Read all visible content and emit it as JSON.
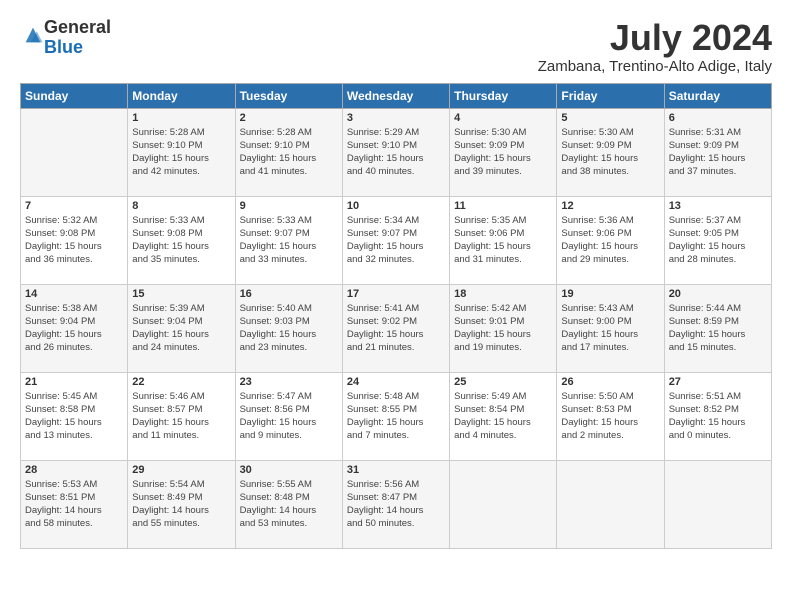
{
  "logo": {
    "general": "General",
    "blue": "Blue"
  },
  "title": "July 2024",
  "location": "Zambana, Trentino-Alto Adige, Italy",
  "days_of_week": [
    "Sunday",
    "Monday",
    "Tuesday",
    "Wednesday",
    "Thursday",
    "Friday",
    "Saturday"
  ],
  "weeks": [
    [
      {
        "day": "",
        "info": ""
      },
      {
        "day": "1",
        "info": "Sunrise: 5:28 AM\nSunset: 9:10 PM\nDaylight: 15 hours\nand 42 minutes."
      },
      {
        "day": "2",
        "info": "Sunrise: 5:28 AM\nSunset: 9:10 PM\nDaylight: 15 hours\nand 41 minutes."
      },
      {
        "day": "3",
        "info": "Sunrise: 5:29 AM\nSunset: 9:10 PM\nDaylight: 15 hours\nand 40 minutes."
      },
      {
        "day": "4",
        "info": "Sunrise: 5:30 AM\nSunset: 9:09 PM\nDaylight: 15 hours\nand 39 minutes."
      },
      {
        "day": "5",
        "info": "Sunrise: 5:30 AM\nSunset: 9:09 PM\nDaylight: 15 hours\nand 38 minutes."
      },
      {
        "day": "6",
        "info": "Sunrise: 5:31 AM\nSunset: 9:09 PM\nDaylight: 15 hours\nand 37 minutes."
      }
    ],
    [
      {
        "day": "7",
        "info": "Sunrise: 5:32 AM\nSunset: 9:08 PM\nDaylight: 15 hours\nand 36 minutes."
      },
      {
        "day": "8",
        "info": "Sunrise: 5:33 AM\nSunset: 9:08 PM\nDaylight: 15 hours\nand 35 minutes."
      },
      {
        "day": "9",
        "info": "Sunrise: 5:33 AM\nSunset: 9:07 PM\nDaylight: 15 hours\nand 33 minutes."
      },
      {
        "day": "10",
        "info": "Sunrise: 5:34 AM\nSunset: 9:07 PM\nDaylight: 15 hours\nand 32 minutes."
      },
      {
        "day": "11",
        "info": "Sunrise: 5:35 AM\nSunset: 9:06 PM\nDaylight: 15 hours\nand 31 minutes."
      },
      {
        "day": "12",
        "info": "Sunrise: 5:36 AM\nSunset: 9:06 PM\nDaylight: 15 hours\nand 29 minutes."
      },
      {
        "day": "13",
        "info": "Sunrise: 5:37 AM\nSunset: 9:05 PM\nDaylight: 15 hours\nand 28 minutes."
      }
    ],
    [
      {
        "day": "14",
        "info": "Sunrise: 5:38 AM\nSunset: 9:04 PM\nDaylight: 15 hours\nand 26 minutes."
      },
      {
        "day": "15",
        "info": "Sunrise: 5:39 AM\nSunset: 9:04 PM\nDaylight: 15 hours\nand 24 minutes."
      },
      {
        "day": "16",
        "info": "Sunrise: 5:40 AM\nSunset: 9:03 PM\nDaylight: 15 hours\nand 23 minutes."
      },
      {
        "day": "17",
        "info": "Sunrise: 5:41 AM\nSunset: 9:02 PM\nDaylight: 15 hours\nand 21 minutes."
      },
      {
        "day": "18",
        "info": "Sunrise: 5:42 AM\nSunset: 9:01 PM\nDaylight: 15 hours\nand 19 minutes."
      },
      {
        "day": "19",
        "info": "Sunrise: 5:43 AM\nSunset: 9:00 PM\nDaylight: 15 hours\nand 17 minutes."
      },
      {
        "day": "20",
        "info": "Sunrise: 5:44 AM\nSunset: 8:59 PM\nDaylight: 15 hours\nand 15 minutes."
      }
    ],
    [
      {
        "day": "21",
        "info": "Sunrise: 5:45 AM\nSunset: 8:58 PM\nDaylight: 15 hours\nand 13 minutes."
      },
      {
        "day": "22",
        "info": "Sunrise: 5:46 AM\nSunset: 8:57 PM\nDaylight: 15 hours\nand 11 minutes."
      },
      {
        "day": "23",
        "info": "Sunrise: 5:47 AM\nSunset: 8:56 PM\nDaylight: 15 hours\nand 9 minutes."
      },
      {
        "day": "24",
        "info": "Sunrise: 5:48 AM\nSunset: 8:55 PM\nDaylight: 15 hours\nand 7 minutes."
      },
      {
        "day": "25",
        "info": "Sunrise: 5:49 AM\nSunset: 8:54 PM\nDaylight: 15 hours\nand 4 minutes."
      },
      {
        "day": "26",
        "info": "Sunrise: 5:50 AM\nSunset: 8:53 PM\nDaylight: 15 hours\nand 2 minutes."
      },
      {
        "day": "27",
        "info": "Sunrise: 5:51 AM\nSunset: 8:52 PM\nDaylight: 15 hours\nand 0 minutes."
      }
    ],
    [
      {
        "day": "28",
        "info": "Sunrise: 5:53 AM\nSunset: 8:51 PM\nDaylight: 14 hours\nand 58 minutes."
      },
      {
        "day": "29",
        "info": "Sunrise: 5:54 AM\nSunset: 8:49 PM\nDaylight: 14 hours\nand 55 minutes."
      },
      {
        "day": "30",
        "info": "Sunrise: 5:55 AM\nSunset: 8:48 PM\nDaylight: 14 hours\nand 53 minutes."
      },
      {
        "day": "31",
        "info": "Sunrise: 5:56 AM\nSunset: 8:47 PM\nDaylight: 14 hours\nand 50 minutes."
      },
      {
        "day": "",
        "info": ""
      },
      {
        "day": "",
        "info": ""
      },
      {
        "day": "",
        "info": ""
      }
    ]
  ]
}
